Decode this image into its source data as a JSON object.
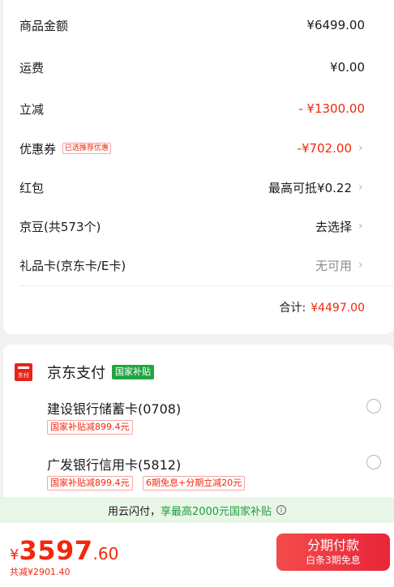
{
  "order": {
    "goods": {
      "label": "商品金额",
      "value": "¥6499.00"
    },
    "shipping": {
      "label": "运费",
      "value": "¥0.00"
    },
    "discount": {
      "label": "立减",
      "value": "- ¥1300.00"
    },
    "coupon": {
      "label": "优惠券",
      "tag": "已选推荐优惠",
      "value": "-¥702.00"
    },
    "redpacket": {
      "label": "红包",
      "value": "最高可抵¥0.22"
    },
    "jdbean": {
      "label": "京豆(共573个)",
      "value": "去选择"
    },
    "giftcard": {
      "label": "礼品卡(京东卡/E卡)",
      "value": "无可用"
    },
    "total": {
      "label": "合计:",
      "value": "¥4497.00"
    }
  },
  "payment": {
    "icon_text": "东付",
    "title": "京东支付",
    "badge": "国家补贴",
    "banks": [
      {
        "name": "建设银行储蓄卡(0708)",
        "tags": [
          "国家补贴减899.4元"
        ]
      },
      {
        "name": "广发银行信用卡(5812)",
        "tags": [
          "国家补贴减899.4元",
          "6期免息+分期立减20元"
        ]
      }
    ]
  },
  "promo": {
    "prefix": "用云闪付，",
    "highlight": "享最高2000元国家补贴",
    "info_icon": "ⓘ"
  },
  "footer": {
    "currency": "¥",
    "price_int": "3597",
    "price_dec": ".60",
    "saved": "共减¥2901.40",
    "button_main": "分期付款",
    "button_sub": "白条3期免息"
  },
  "colors": {
    "accent": "#f2270c",
    "green": "#23a443",
    "promo_bg": "#e8f6e8"
  }
}
